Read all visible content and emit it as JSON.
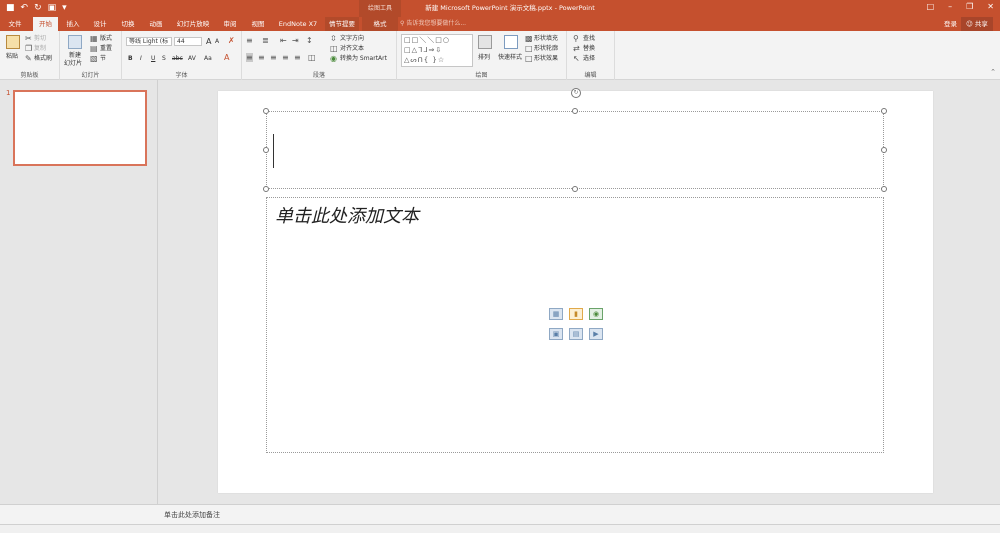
{
  "app": {
    "window_title": "新建 Microsoft PowerPoint 演示文稿.pptx - PowerPoint",
    "contextual_group": "绘图工具",
    "login": "登录",
    "share": "共享"
  },
  "quick_access": {
    "save_icon": "save-icon",
    "undo_icon": "undo-icon",
    "redo_icon": "redo-icon",
    "present_icon": "present-icon",
    "customize_icon": "customize-icon"
  },
  "tabs": [
    "文件",
    "开始",
    "插入",
    "设计",
    "切换",
    "动画",
    "幻灯片放映",
    "审阅",
    "视图",
    "EndNote X7",
    "情节提要",
    "格式"
  ],
  "active_tab": "开始",
  "tell_me": "告诉我您想要做什么...",
  "ribbon": {
    "clipboard": {
      "paste": "粘贴",
      "cut": "剪切",
      "copy": "复制",
      "format_painter": "格式刷",
      "label": "剪贴板"
    },
    "slides": {
      "new_slide": "新建",
      "new_slide_2": "幻灯片",
      "layout": "版式",
      "reset": "重置",
      "section": "节",
      "label": "幻灯片"
    },
    "font": {
      "font_name": "等线 Light (标",
      "font_size": "44",
      "bold": "B",
      "italic": "I",
      "underline": "U",
      "strike": "S",
      "shadow": "abc",
      "spacing": "AV",
      "case": "Aa",
      "grow": "A",
      "shrink": "A",
      "label": "字体"
    },
    "paragraph": {
      "text_direction": "文字方向",
      "align_text": "对齐文本",
      "smartart": "转换为 SmartArt",
      "label": "段落"
    },
    "drawing": {
      "arrange": "排列",
      "quick_styles": "快速样式",
      "shape_fill": "形状填充",
      "shape_outline": "形状轮廓",
      "shape_effects": "形状效果",
      "label": "绘图"
    },
    "editing": {
      "find": "查找",
      "replace": "替换",
      "select": "选择",
      "label": "编辑"
    }
  },
  "thumbnails": [
    {
      "number": "1"
    }
  ],
  "slide": {
    "body_placeholder": "单击此处添加文本"
  },
  "notes": {
    "placeholder": "单击此处添加备注"
  },
  "colors": {
    "accent": "#c5502e",
    "ribbon_bg": "#f3f3f3",
    "workspace_bg": "#e6e6e6"
  }
}
